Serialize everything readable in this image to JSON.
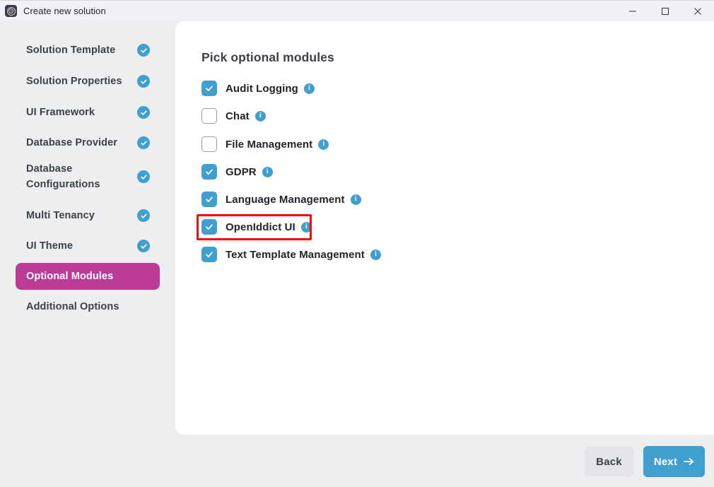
{
  "window": {
    "title": "Create new solution",
    "icon": "abp-logo-icon",
    "controls": {
      "minimize": "minimize-icon",
      "maximize": "maximize-icon",
      "close": "close-icon"
    }
  },
  "sidebar": {
    "items": [
      {
        "label": "Solution Template",
        "completed": true,
        "active": false
      },
      {
        "label": "Solution Properties",
        "completed": true,
        "active": false
      },
      {
        "label": "UI Framework",
        "completed": true,
        "active": false
      },
      {
        "label": "Database Provider",
        "completed": true,
        "active": false
      },
      {
        "label": "Database Configurations",
        "completed": true,
        "active": false
      },
      {
        "label": "Multi Tenancy",
        "completed": true,
        "active": false
      },
      {
        "label": "UI Theme",
        "completed": true,
        "active": false
      },
      {
        "label": "Optional Modules",
        "completed": false,
        "active": true
      },
      {
        "label": "Additional Options",
        "completed": false,
        "active": false
      }
    ]
  },
  "main": {
    "heading": "Pick optional modules",
    "modules": [
      {
        "label": "Audit Logging",
        "checked": true,
        "info": "info-icon",
        "highlighted": false
      },
      {
        "label": "Chat",
        "checked": false,
        "info": "info-icon",
        "highlighted": false
      },
      {
        "label": "File Management",
        "checked": false,
        "info": "info-icon",
        "highlighted": false
      },
      {
        "label": "GDPR",
        "checked": true,
        "info": "info-icon",
        "highlighted": false
      },
      {
        "label": "Language Management",
        "checked": true,
        "info": "info-icon",
        "highlighted": false
      },
      {
        "label": "OpenIddict UI",
        "checked": true,
        "info": "info-icon",
        "highlighted": true
      },
      {
        "label": "Text Template Management",
        "checked": true,
        "info": "info-icon",
        "highlighted": false
      }
    ]
  },
  "footer": {
    "back_label": "Back",
    "next_label": "Next",
    "next_icon": "arrow-right-icon"
  },
  "colors": {
    "accent_blue": "#3f9fd0",
    "active_magenta": "#bb3c96",
    "highlight_red": "#f60b0b",
    "panel_bg": "#ffffff",
    "app_bg": "#edeef0",
    "titlebar_bg": "#f0f1f5"
  }
}
